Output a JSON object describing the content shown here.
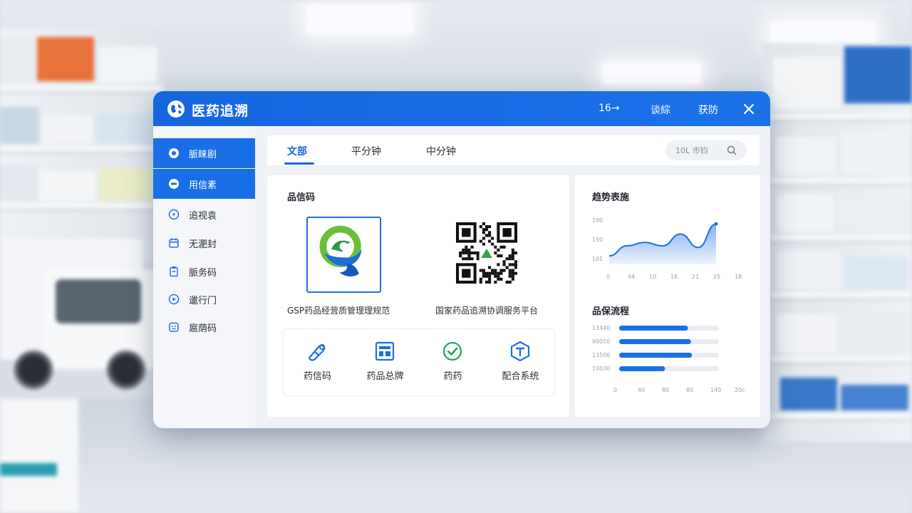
{
  "app": {
    "title": "医药追溯"
  },
  "header_nav": [
    "16→",
    "谈綜",
    "获防"
  ],
  "sidebar": {
    "items": [
      {
        "label": "脈睐剧",
        "active": true
      },
      {
        "label": "用信素",
        "active": true
      },
      {
        "label": "追视袁",
        "active": false
      },
      {
        "label": "无淝封",
        "active": false
      },
      {
        "label": "脈务码",
        "active": false
      },
      {
        "label": "邋行门",
        "active": false
      },
      {
        "label": "扈荫码",
        "active": false
      }
    ]
  },
  "tabs": [
    {
      "label": "文部",
      "active": true
    },
    {
      "label": "平分钟",
      "active": false
    },
    {
      "label": "中分钟",
      "active": false
    }
  ],
  "search": {
    "placeholder": "10L 市钧"
  },
  "main_panel": {
    "title": "品信码",
    "cards": [
      {
        "caption": "GSP药品经营质管理理规范",
        "icon": "brand-logo-icon"
      },
      {
        "caption": "国家药品追溯协调服务平台",
        "icon": "qr-code-icon"
      }
    ],
    "features": [
      {
        "label": "药信码",
        "icon": "pill-icon"
      },
      {
        "label": "药品总牌",
        "icon": "dashboard-icon"
      },
      {
        "label": "药药",
        "icon": "check-circle-icon"
      },
      {
        "label": "配合系统",
        "icon": "shield-icon"
      }
    ]
  },
  "trend_panel": {
    "title": "趋势表施"
  },
  "bars_panel": {
    "title": "品保流程"
  },
  "colors": {
    "primary": "#1a6fe6",
    "bar_track": "#e9edf3",
    "area_fill": "#cfe0fb"
  },
  "chart_data": [
    {
      "type": "area",
      "title": "趋势表施",
      "x": [
        "0",
        "44",
        "10",
        "16",
        "21",
        "25",
        "18"
      ],
      "y_ticks": [
        "100",
        "150",
        "101"
      ],
      "series": [
        {
          "values": [
            20,
            44,
            52,
            44,
            72,
            40,
            96
          ]
        }
      ],
      "ylim": [
        0,
        110
      ],
      "grid": false
    },
    {
      "type": "bar",
      "orientation": "horizontal",
      "title": "品保流程",
      "categories": [
        "13440",
        "90010",
        "13500",
        "10030"
      ],
      "values": [
        0.69,
        0.72,
        0.73,
        0.46
      ],
      "x_ticks": [
        "0",
        "40",
        "80",
        "80",
        "140",
        "20c"
      ]
    }
  ]
}
